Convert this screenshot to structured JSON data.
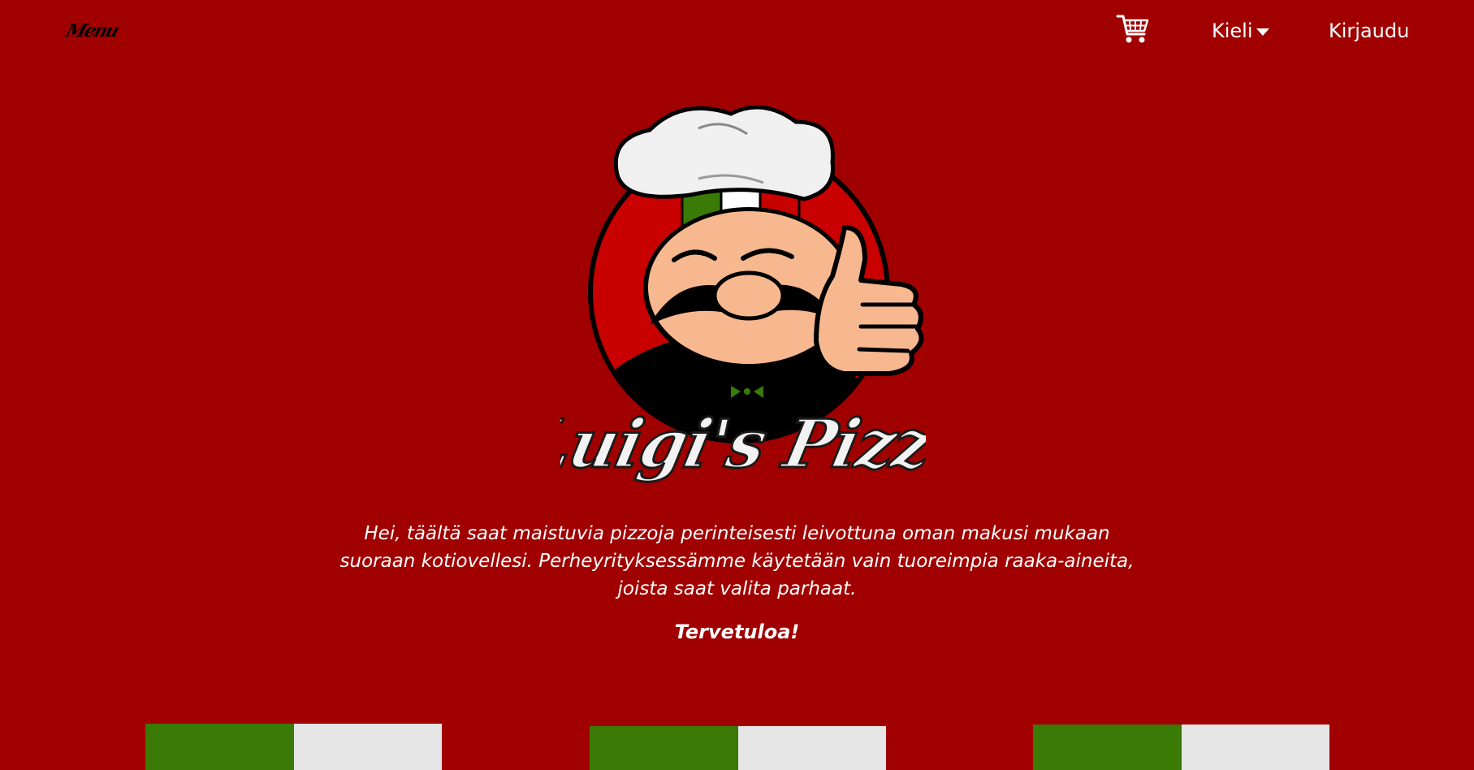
{
  "nav": {
    "menu_label": "Menu",
    "cart_icon": "shopping-cart-icon",
    "language_label": "Kieli",
    "language_caret_icon": "caret-down-icon",
    "login_label": "Kirjaudu"
  },
  "logo": {
    "text": "Luigi's Pizza",
    "icon": "chef-thumbs-up-icon"
  },
  "intro": {
    "text": "Hei, täältä saat maistuvia pizzoja perinteisesti leivottuna oman makusi mukaan suoraan kotiovellesi. Perheyrityksessämme käytetään vain tuoreimpia raaka-aineita, joista saat valita parhaat.",
    "welcome": "Tervetuloa!"
  },
  "colors": {
    "background": "#a10000",
    "flag_green": "#3a7a07",
    "flag_white": "#e6e6e6",
    "flag_red": "#c80000",
    "text": "#ffffff"
  }
}
